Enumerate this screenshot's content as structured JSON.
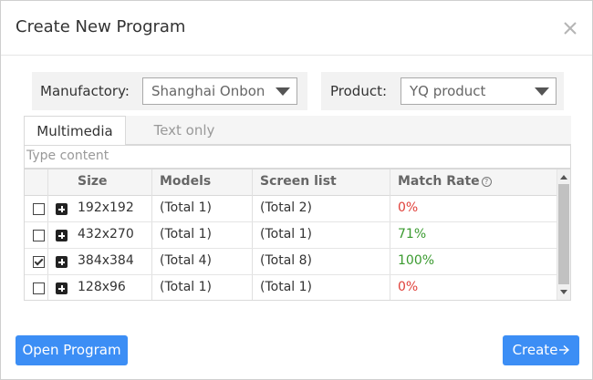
{
  "dialog": {
    "title": "Create New Program",
    "close_icon": "close-icon"
  },
  "filters": {
    "manufactory_label": "Manufactory:",
    "manufactory_value": "Shanghai Onbon",
    "product_label": "Product:",
    "product_value": "YQ product"
  },
  "tabs": [
    {
      "label": "Multimedia",
      "active": true
    },
    {
      "label": "Text only",
      "active": false
    }
  ],
  "search": {
    "placeholder": "Type content"
  },
  "table": {
    "headers": {
      "size": "Size",
      "models": "Models",
      "screens": "Screen list",
      "match_rate": "Match Rate"
    },
    "rows": [
      {
        "checked": false,
        "size": "192x192",
        "models": "(Total 1)",
        "screens": "(Total 2)",
        "rate": "0%",
        "rate_color": "#e0403a"
      },
      {
        "checked": false,
        "size": "432x270",
        "models": "(Total 1)",
        "screens": "(Total 1)",
        "rate": "71%",
        "rate_color": "#3a9a2f"
      },
      {
        "checked": true,
        "size": "384x384",
        "models": "(Total 4)",
        "screens": "(Total 8)",
        "rate": "100%",
        "rate_color": "#3a9a2f"
      },
      {
        "checked": false,
        "size": "128x96",
        "models": "(Total 1)",
        "screens": "(Total 1)",
        "rate": "0%",
        "rate_color": "#e0403a"
      }
    ]
  },
  "buttons": {
    "open_program": "Open Program",
    "create": "Create",
    "create_icon": "arrow-right-icon"
  },
  "colors": {
    "accent": "#3c8ef5",
    "rate_low": "#e0403a",
    "rate_high": "#3a9a2f"
  }
}
